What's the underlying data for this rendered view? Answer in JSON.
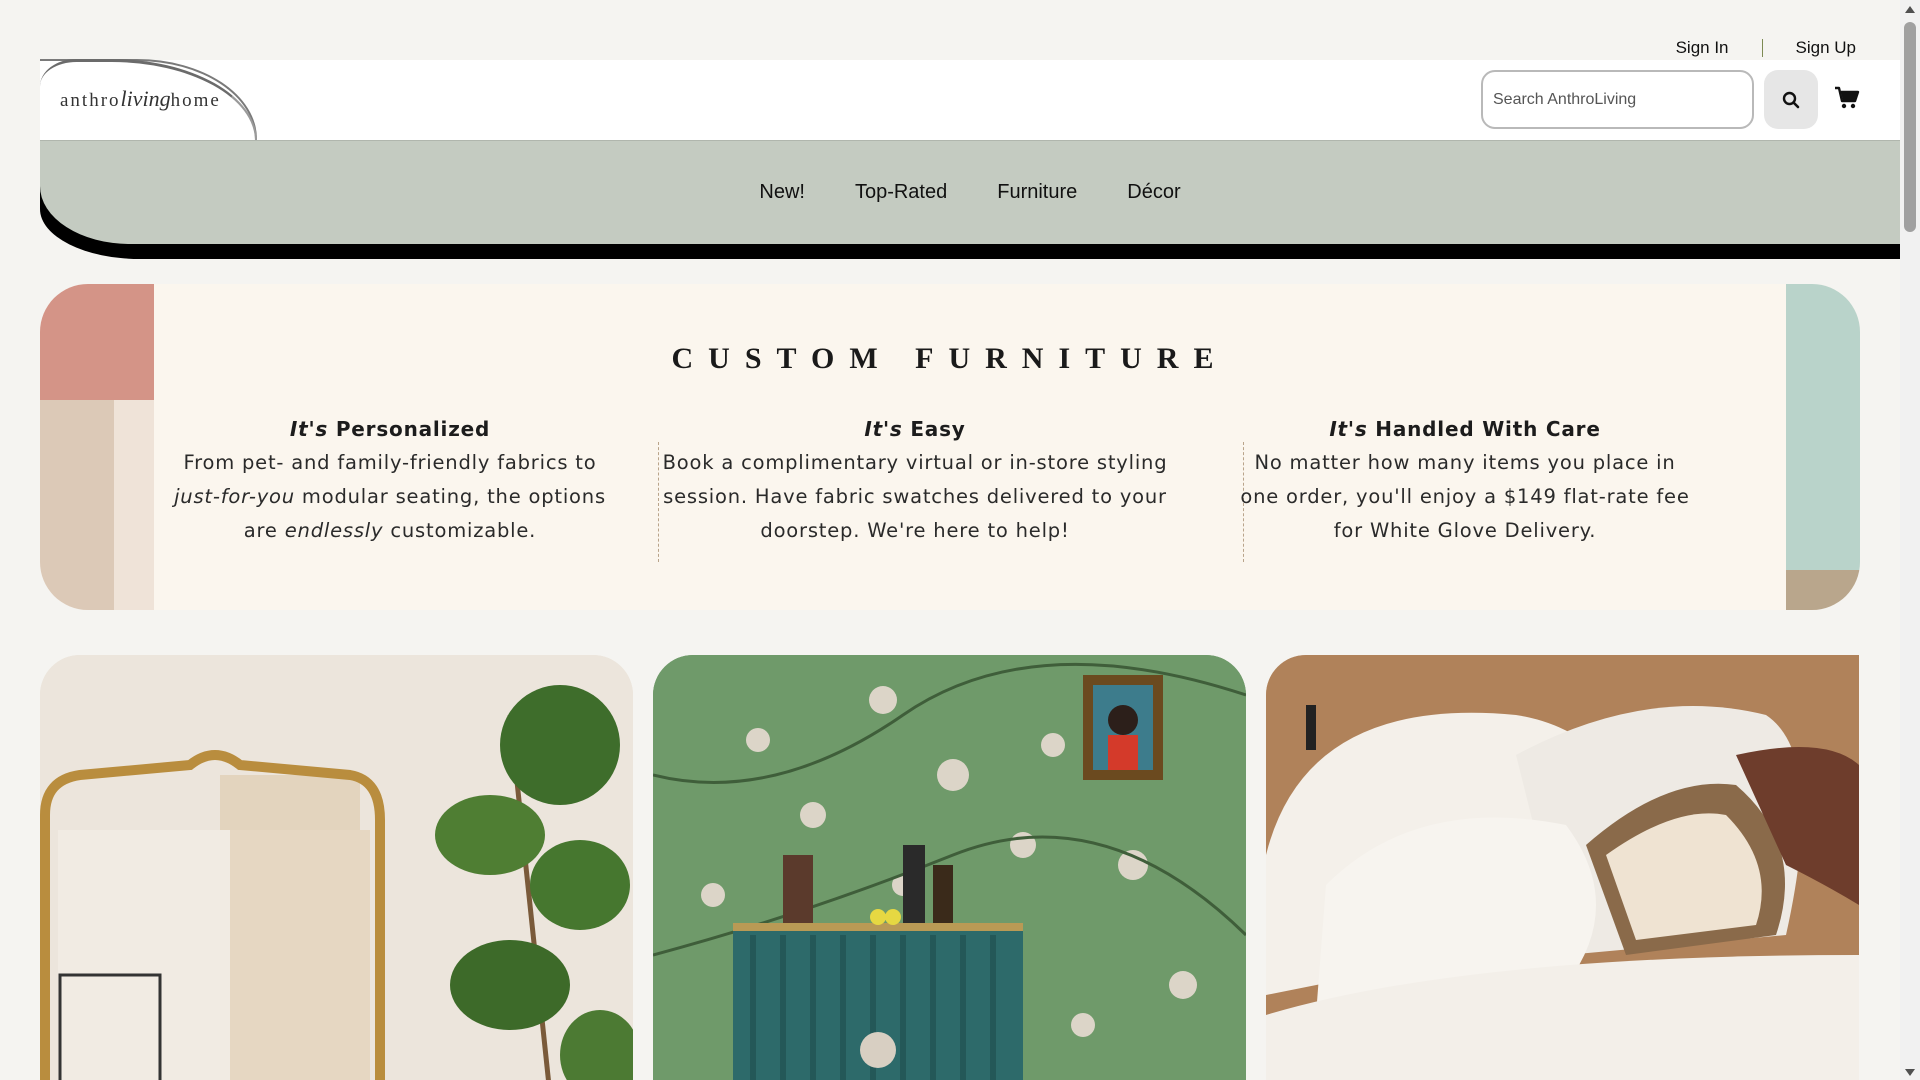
{
  "auth": {
    "sign_in": "Sign In",
    "sign_up": "Sign Up"
  },
  "logo": {
    "part1": "anthro",
    "part2": "living",
    "part3": "home"
  },
  "search": {
    "placeholder": "Search AnthroLiving"
  },
  "nav": {
    "items": [
      "New!",
      "Top-Rated",
      "Furniture",
      "Décor"
    ]
  },
  "banner": {
    "title": "CUSTOM FURNITURE",
    "features": [
      {
        "title_prefix": "It's",
        "title_rest": " Personalized",
        "line1": "From pet- and family-friendly fabrics to",
        "line2_em": "just-for-you",
        "line2_rest": " modular seating, the options",
        "line3_a": "are ",
        "line3_em": "endlessly",
        "line3_b": " customizable."
      },
      {
        "title_prefix": "It's",
        "title_rest": " Easy",
        "text": "Book a complimentary virtual or in-store styling session. Have fabric swatches delivered to your doorstep. We're here to help!"
      },
      {
        "title_prefix": "It's",
        "title_rest": " Handled With Care",
        "text": "No matter how many items you place in one order, you'll enjoy a $149 flat-rate fee for White Glove Delivery."
      }
    ]
  },
  "tiles": [
    {
      "icon": "mirror-with-plant-image"
    },
    {
      "icon": "green-floral-cabinet-image"
    },
    {
      "icon": "white-pillows-bed-image"
    }
  ],
  "colors": {
    "nav_bg": "#c4cbc1",
    "banner_bg": "#fbf6ee",
    "accent_pink": "#d49487",
    "accent_teal": "#b9d3ca"
  }
}
